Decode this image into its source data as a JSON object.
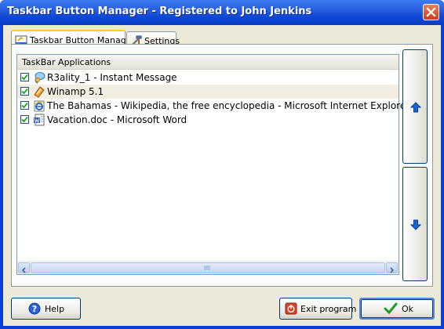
{
  "window": {
    "title": "Taskbar Button Manager - Registered to John Jenkins"
  },
  "tabs": [
    {
      "label": "Taskbar Button Manager",
      "active": true
    },
    {
      "label": "Settings",
      "active": false
    }
  ],
  "list": {
    "header": "TaskBar Applications",
    "items": [
      {
        "label": "R3ality_1 - Instant Message",
        "checked": true,
        "icon": "messenger-icon"
      },
      {
        "label": "Winamp 5.1",
        "checked": true,
        "icon": "winamp-icon",
        "selected": true
      },
      {
        "label": "The Bahamas - Wikipedia, the free encyclopedia - Microsoft Internet Explorer",
        "checked": true,
        "icon": "internet-explorer-icon"
      },
      {
        "label": "Vacation.doc - Microsoft Word",
        "checked": true,
        "icon": "word-document-icon"
      }
    ]
  },
  "side_buttons": {
    "up": "arrow-up-icon",
    "down": "arrow-down-icon"
  },
  "buttons": {
    "help": "Help",
    "exit": "Exit program",
    "ok": "Ok"
  },
  "colors": {
    "title_bar": "#0a46d4",
    "accent_blue": "#1565d8",
    "client_bg": "#ece9d8"
  }
}
